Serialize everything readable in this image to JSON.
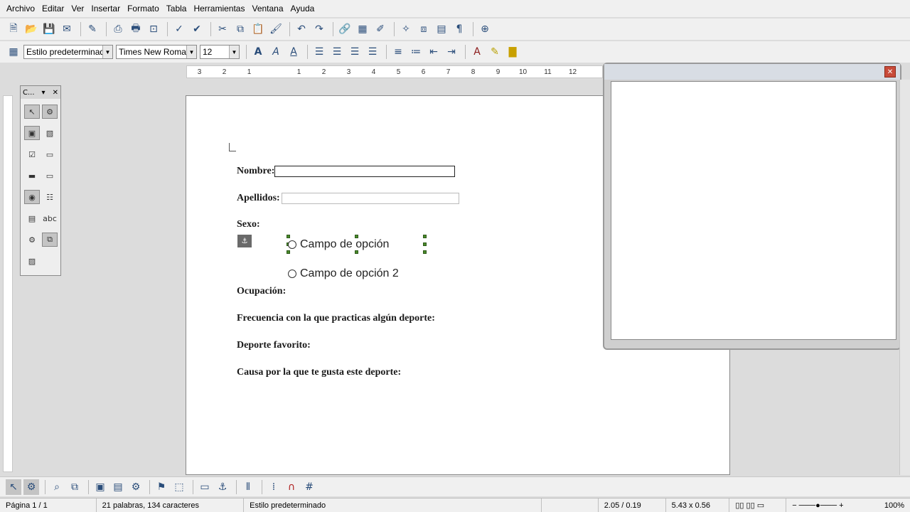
{
  "menu": [
    "Archivo",
    "Editar",
    "Ver",
    "Insertar",
    "Formato",
    "Tabla",
    "Herramientas",
    "Ventana",
    "Ayuda"
  ],
  "toolbar_format": {
    "paragraph_style": "Estilo predeterminado",
    "font_name": "Times New Roman",
    "font_size": "12"
  },
  "ruler": {
    "marks": [
      "3",
      "2",
      "1",
      "",
      "1",
      "2",
      "3",
      "4",
      "5",
      "6",
      "7",
      "8",
      "9",
      "10",
      "11",
      "12"
    ]
  },
  "document": {
    "nombre_label": "Nombre:",
    "apellidos_label": "Apellidos:",
    "sexo_label": "Sexo:",
    "radio1_label": "Campo de opción",
    "radio2_label": "Campo de opción 2",
    "ocupacion_label": "Ocupación:",
    "frecuencia_label": "Frecuencia con la que practicas algún deporte:",
    "deporte_label": "Deporte favorito:",
    "causa_label": "Causa por la que te gusta este deporte:"
  },
  "form_toolbar": {
    "title": "C..."
  },
  "status": {
    "page": "Página 1 / 1",
    "words": "21 palabras, 134 caracteres",
    "style": "Estilo predeterminado",
    "position": "2.05 / 0.19",
    "size": "5.43 x 0.56",
    "zoom": "100%"
  },
  "colors": {
    "selection_handle": "#4a8a2a",
    "close_button": "#c84b3a"
  }
}
